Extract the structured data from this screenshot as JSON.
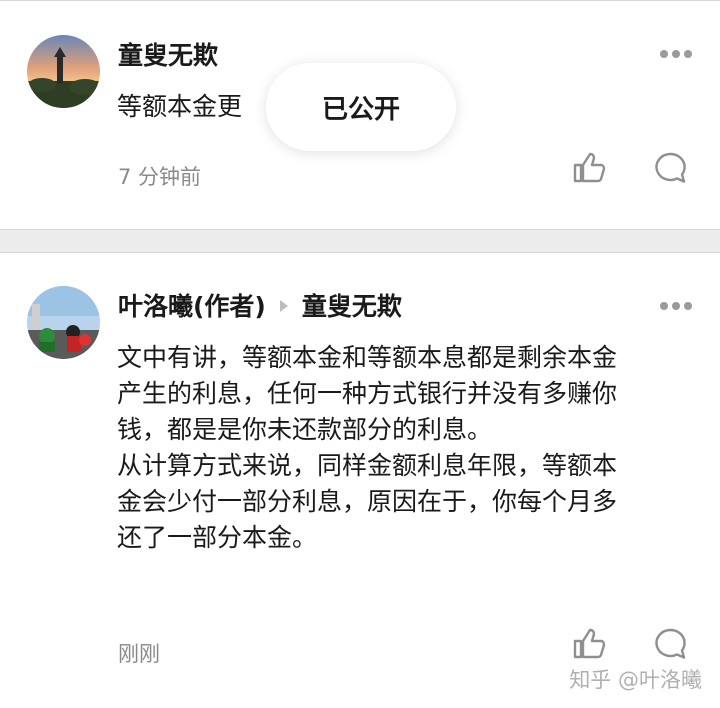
{
  "comment1": {
    "author": "童叟无欺",
    "content_visible": "等额本金更",
    "time": "7 分钟前"
  },
  "toast": {
    "text": "已公开"
  },
  "comment2": {
    "author": "叶洛曦(作者)",
    "reply_to": "童叟无欺",
    "lines": [
      "文中有讲，等额本金和等额本息都是剩余本金",
      "产生的利息，任何一种方式银行并没有多赚你",
      "钱，都是是你未还款部分的利息。",
      "从计算方式来说，同样金额利息年限，等额本",
      "金会少付一部分利息，原因在于，你每个月多",
      "还了一部分本金。"
    ],
    "time": "刚刚"
  },
  "watermark": "知乎 @叶洛曦",
  "icons": {
    "more": "more-dots-icon",
    "like": "thumbs-up-icon",
    "reply": "comment-bubble-icon"
  },
  "colors": {
    "divider": "#ececec",
    "time": "#8a8a8a",
    "icon": "#9a9a9a"
  }
}
